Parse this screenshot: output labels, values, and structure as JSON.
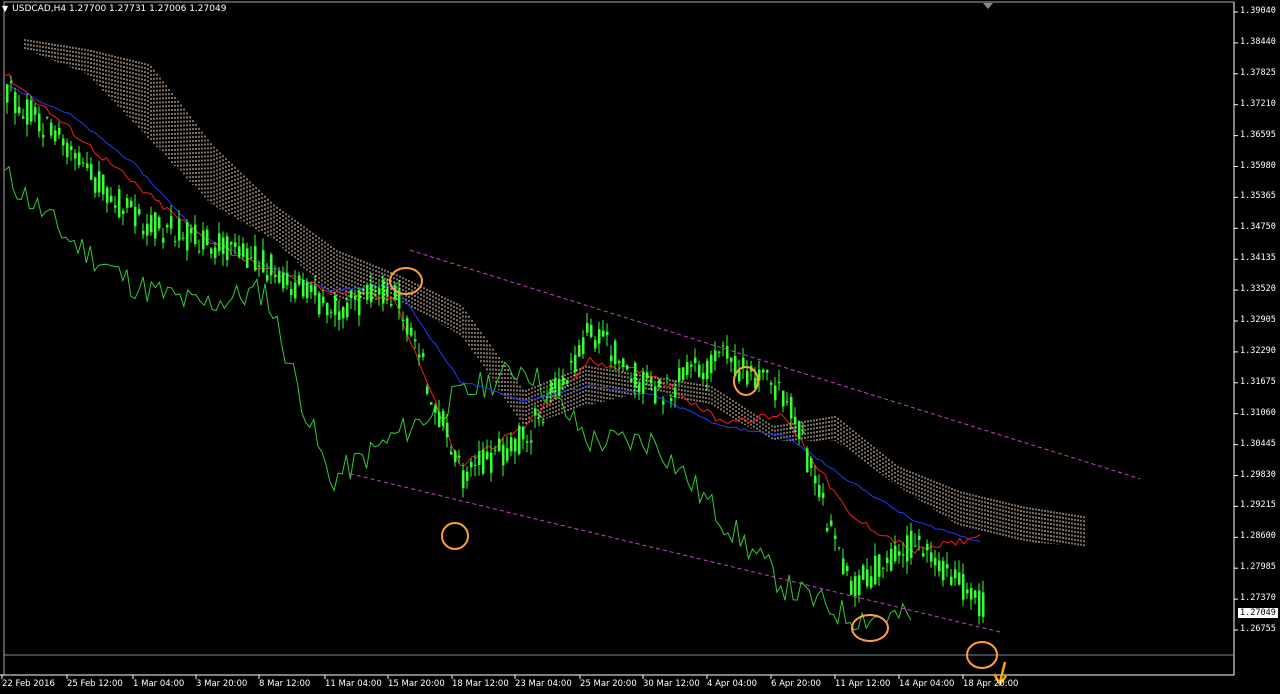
{
  "header": {
    "symbol_line": "USDCAD,H4  1.27700 1.27731 1.27006 1.27049"
  },
  "current_price": "1.27049",
  "price_axis": [
    "1.39040",
    "1.38440",
    "1.37825",
    "1.37210",
    "1.36595",
    "1.35980",
    "1.35365",
    "1.34750",
    "1.34135",
    "1.33520",
    "1.32905",
    "1.32290",
    "1.31675",
    "1.31060",
    "1.30445",
    "1.29830",
    "1.29215",
    "1.28600",
    "1.27985",
    "1.27370",
    "1.26755"
  ],
  "time_axis": [
    "22 Feb 2016",
    "25 Feb 12:00",
    "1 Mar 04:00",
    "3 Mar 20:00",
    "8 Mar 12:00",
    "11 Mar 04:00",
    "15 Mar 20:00",
    "18 Mar 12:00",
    "23 Mar 04:00",
    "25 Mar 20:00",
    "30 Mar 12:00",
    "4 Apr 04:00",
    "6 Apr 20:00",
    "11 Apr 12:00",
    "14 Apr 04:00",
    "18 Apr 20:00"
  ],
  "colors": {
    "price": "#33ff33",
    "chikou": "#32cd32",
    "tenkan": "#ff1a1a",
    "kijun": "#1e3cff",
    "channel": "#d23cd2",
    "marker": "#ff9f3f",
    "arrow": "#ffa500",
    "cloud": "#ffe0c8",
    "axis": "#ffffff"
  },
  "chart_data": {
    "type": "line",
    "title": "",
    "xlabel": "",
    "ylabel": "",
    "x": [
      "22 Feb 2016",
      "25 Feb 12:00",
      "1 Mar 04:00",
      "3 Mar 20:00",
      "8 Mar 12:00",
      "11 Mar 04:00",
      "15 Mar 20:00",
      "18 Mar 12:00",
      "23 Mar 04:00",
      "25 Mar 20:00",
      "30 Mar 12:00",
      "4 Apr 04:00",
      "6 Apr 20:00",
      "11 Apr 12:00",
      "14 Apr 04:00",
      "18 Apr 20:00"
    ],
    "ylim": [
      1.2651,
      1.3929
    ],
    "series": [
      {
        "values": [
          1.375,
          1.362,
          1.349,
          1.345,
          1.34,
          1.331,
          1.335,
          1.298,
          1.306,
          1.327,
          1.314,
          1.322,
          1.314,
          1.276,
          1.285,
          1.272
        ]
      },
      {
        "values": [
          1.378,
          1.367,
          1.356,
          1.346,
          1.339,
          1.335,
          1.333,
          1.3,
          1.308,
          1.321,
          1.318,
          1.309,
          1.31,
          1.29,
          1.283,
          1.286
        ]
      },
      {
        "values": [
          1.376,
          1.37,
          1.36,
          1.346,
          1.34,
          1.335,
          1.336,
          1.317,
          1.313,
          1.316,
          1.314,
          1.308,
          1.306,
          1.297,
          1.289,
          1.285
        ]
      },
      {
        "values": [
          1.358,
          1.345,
          1.336,
          1.332,
          1.335,
          1.297,
          1.306,
          1.314,
          1.32,
          1.305,
          1.305,
          1.29,
          1.276,
          1.27,
          null,
          null
        ]
      }
    ]
  }
}
